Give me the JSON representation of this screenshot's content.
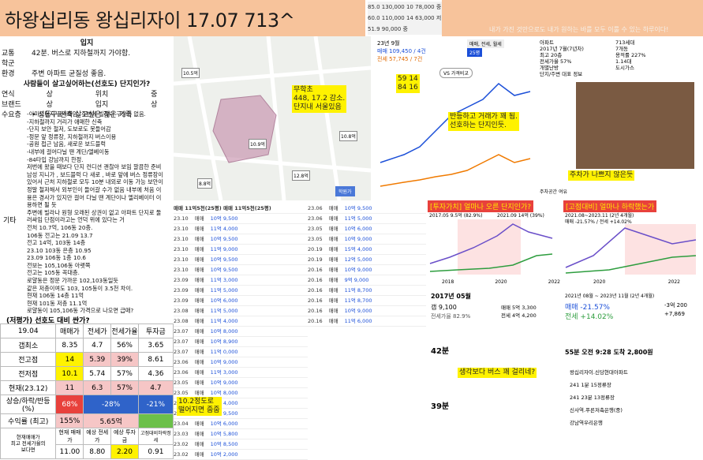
{
  "header": {
    "title": "하왕십리동 왕십리자이 17.07   713^",
    "stats": [
      "85.0 130,000 10 78,000 중",
      "60.0 110,000 14 63,000 저",
      "51.9 90,000 중"
    ],
    "banner": "내가 가진 것만으로도 내가 원하는 바를 모두 이룰 수 있는 하루이다!"
  },
  "info": {
    "section_label": "입지",
    "rows": [
      {
        "label": "교통",
        "value": "42분. 버스로 지하철까지 가야함."
      },
      {
        "label": "학군",
        "value": ""
      },
      {
        "label": "환경",
        "value": "주변 아파트 균질성 좋음."
      },
      {
        "label": "",
        "value": "사람들이 살고싶어하는(선호도) 단지인가?"
      },
      {
        "label": "연식",
        "value": "상",
        "k2": "위치",
        "v2": "중"
      },
      {
        "label": "브랜드",
        "value": "상",
        "k2": "입지",
        "v2": "상"
      },
      {
        "label": "수요층",
        "value": "• 성동구 신축 살고싶은 젊은 가족"
      }
    ],
    "other_label": "기타",
    "notes": "-이미드단지 플러체임, 주변에 빌라나 구상권 없음.\n-지하철까지 거리가 애매한 신축\n-단지 보안 철저, 도보로도 못들어감\n-정문 앞 정류장, 지하철까지 버스이용\n-공원 접근 남음, 새로운 보드블럭\n-내부에 걸어다닐 땐 계단/엘베이동\n-84타입 강남까지 한정.\n저번에 왔을 때보다 단지 컨디션 괜찮아 보임 깔끔한 준비\n남성 지니가 , 보드블럭 다 새로 , 바로 앞에 버스 정류장이\n있어서 근처 지하철로 모두 10분 내외로 이동 가능 보안이\n정말 철저해서 외부인이 들어갈 수가 없음 내부에 처음 이\n용은 경사가 있지만 걸어 다닐 땐 계단이나 엘리베이터 이\n용하면 될 듯\n주변에 빌라나 원형 오래된 상권이 없고 아파트 단지로 둘\n러싸임 단점이라고는 언덕 위에 있다는 거\n전처 10.7억, 106동 20층.\n106동 전고는 21.09  13.7\n전고 14억, 103동 14층\n23.10  103동 은층 10.95\n23.09 106동 1층 10.6\n전보는 105,106동 아랫쪽\n전고는 105동 꼭대층.\n로얄동은 정문 가까운 102,103동일듯\n같은 저층이여도 103, 105동이 3.5천 차이.\n현재 106동 14층 11억\n현재 101동 저층 11.1억\n로얄동이 105,106동 가격으로 나오면 급매?"
  },
  "compare": {
    "title": "(저평가) 선호도 대비 싼가?",
    "header": [
      "19.04",
      "매매가",
      "전세가",
      "전세가율",
      "투자금"
    ],
    "rows": [
      [
        "갭최소",
        "8.35",
        "4.7",
        "56%",
        "3.65"
      ],
      [
        "전고점",
        "14",
        "5.39",
        "39%",
        "8.61"
      ],
      [
        "전저점",
        "10.1",
        "5.74",
        "57%",
        "4.36"
      ],
      [
        "현재(23.12)",
        "11",
        "6.3",
        "57%",
        "4.7"
      ]
    ],
    "change_label": "상승/하락/반등(%)",
    "changes": [
      "68%",
      "-28%",
      "-21%"
    ],
    "rate_label": "수익률 (최고)",
    "rates": [
      "155%",
      "5.65억"
    ],
    "bottom_label": "현재매매가\n최고 전세가율의\n보다면",
    "bottom_header": [
      "현재 매매가",
      "예상 전세가",
      "예상 투자금",
      "고점대비하락정세"
    ],
    "bottom_values": [
      "11.00",
      "8.80",
      "2.20",
      "0.91"
    ]
  },
  "map": {
    "note": "무학초\n448, 17.2 감소.\n단지내 서울있음",
    "prices": [
      "10.5억",
      "8.8억",
      "10.9억",
      "10.8억",
      "12.8억",
      "11.7억",
      "7.9억"
    ],
    "button": "학원가"
  },
  "chart1": {
    "tabs": [
      "매매, 전세, 월세",
      "25평",
      "VS 가격비교"
    ],
    "summary": [
      "23년 9월",
      "매매 109,450 / 4건",
      "전세 57,745 / 7건"
    ],
    "labels": [
      "59 14",
      "84 16"
    ],
    "note": "반등하고 거래가 꽤 됨.\n선호하는 단지인듯.",
    "years": [
      "17년",
      "18년",
      "19년",
      "20년",
      "21년",
      "22년",
      "23년"
    ]
  },
  "floor": {
    "facts": [
      "아파트",
      "2017년 7월(7년차)",
      "최고 20층",
      "전세가율 57%",
      "개별난방",
      "단지/주변 대표 정보"
    ],
    "facts_right": [
      "713세대",
      "7개동",
      "용적률 227%",
      "1.14대",
      "도시가스"
    ],
    "note": "주차가 나쁘지 않은듯",
    "footer": "주차공간 여유"
  },
  "list1": {
    "tabs": [
      "매매 11억5천(25평)",
      "매매 11억5천(25평)"
    ],
    "rows": [
      [
        "23.10",
        "매매",
        "10억 9,500"
      ],
      [
        "23.10",
        "매매",
        "11억 4,000"
      ],
      [
        "23.10",
        "매매",
        "10억 9,500"
      ],
      [
        "23.10",
        "매매",
        "11억 9,000"
      ],
      [
        "23.10",
        "매매",
        "10억 9,500"
      ],
      [
        "23.10",
        "매매",
        "10억 9,500"
      ],
      [
        "23.09",
        "매매",
        "11억 3,000"
      ],
      [
        "23.09",
        "매매",
        "11억 5,000"
      ],
      [
        "23.09",
        "매매",
        "10억 6,000"
      ],
      [
        "23.08",
        "매매",
        "11억 5,000"
      ],
      [
        "23.08",
        "매매",
        "11억 4,000"
      ],
      [
        "23.07",
        "매매",
        "10억 8,000"
      ],
      [
        "23.07",
        "매매",
        "10억 8,900"
      ],
      [
        "23.07",
        "매매",
        "11억 0,000"
      ],
      [
        "23.06",
        "매매",
        "10억 9,000"
      ],
      [
        "23.06",
        "매매",
        "11억 3,000"
      ],
      [
        "23.05",
        "매매",
        "10억 9,000"
      ],
      [
        "23.05",
        "매매",
        "10억 8,000"
      ],
      [
        "23.04",
        "매매",
        "11억 4,000"
      ],
      [
        "23.04",
        "매매",
        "10억 9,500"
      ],
      [
        "23.04",
        "매매",
        "10억 6,000"
      ],
      [
        "23.03",
        "매매",
        "10억 5,800"
      ],
      [
        "23.02",
        "매매",
        "10억 8,500"
      ],
      [
        "23.02",
        "매매",
        "10억 2,000"
      ]
    ],
    "note": "10.2정도로\n떨어지면 줍줍"
  },
  "list2": {
    "rows": [
      [
        "23.06",
        "매매",
        "10억 9,500"
      ],
      [
        "23.06",
        "매매",
        "11억 5,000"
      ],
      [
        "23.05",
        "매매",
        "10억 6,000"
      ],
      [
        "23.05",
        "매매",
        "10억 9,000"
      ],
      [
        "20.19",
        "매매",
        "15억 4,000"
      ],
      [
        "20.19",
        "매매",
        "12억 5,000"
      ],
      [
        "20.16",
        "매매",
        "10억 9,000"
      ],
      [
        "20.16",
        "매매",
        "9억 9,000"
      ],
      [
        "20.16",
        "매매",
        "11억 8,700"
      ],
      [
        "20.16",
        "매매",
        "11억 8,700"
      ],
      [
        "20.16",
        "매매",
        "10억 9,000"
      ],
      [
        "20.16",
        "매매",
        "11억 6,000"
      ]
    ]
  },
  "chart2": {
    "title": "[투자가치] 얼마나 오른 단지인가?",
    "stats": [
      "2017.05 9.5억 (82.9%)",
      "2021.09 14억 (39%)"
    ],
    "years": [
      "2018",
      "2020",
      "2022"
    ]
  },
  "chart3": {
    "title": "[고점대비] 얼마나 하락했는가",
    "stats": [
      "2021.08~2023.11 (2년 4개월)",
      "매매 -21.57% / 전세 +14.02%"
    ],
    "years": [
      "2020",
      "2022"
    ]
  },
  "panelB": {
    "date": "2017년 05월",
    "price": "갭 9,100",
    "rate": "전세가율 82.9%",
    "deal_low": "매매 5억 3,300",
    "deal_high": "전세 4억 4,200",
    "note": "생각보다 버스 꽤 걸리네?",
    "stops": [
      "42분",
      "39분"
    ]
  },
  "panelC": {
    "period": "2021년 08월 ~ 2023년 11월 (2년 4개월)",
    "sale": "매매 -21.57%",
    "sale_amt": "-3억 200",
    "jeonse": "전세 +14.02%",
    "jeonse_amt": "+7,869",
    "route": "55분 오전 9:28 도착 2,800원",
    "stops": [
      "왕십리자이.신당현대아파트",
      "241 1분 15정류장",
      "241 23분 13정류장",
      "신사역.푸른저축은행(중)",
      "강남역우리은행"
    ]
  },
  "colors": {
    "accent": "#f7c39b",
    "note": "#fff200",
    "red": "#e8413c",
    "blue": "#2f63c9",
    "green": "#6cc04a"
  }
}
